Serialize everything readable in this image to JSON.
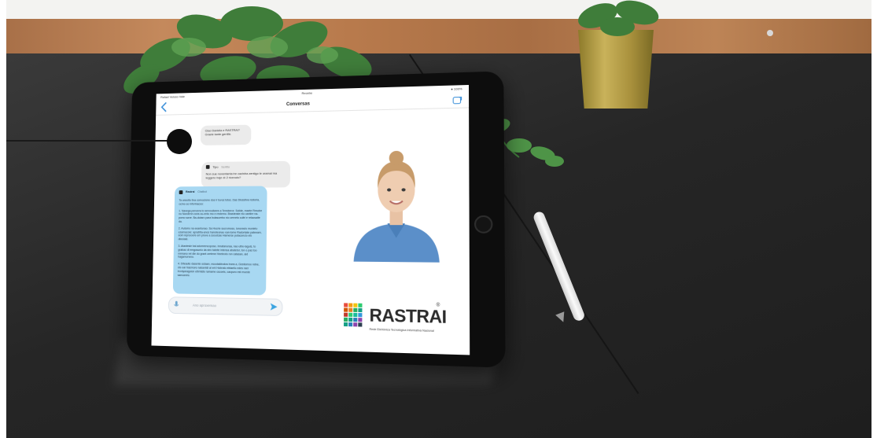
{
  "tablet": {
    "status_left": "Rafael Veloso  Vale",
    "status_center": "Recebe",
    "status_right": "● 100%",
    "nav_title": "Conversas",
    "messages": [
      {
        "role": "user",
        "text": "Ciao Daniela e RASTRAI? Grazie tante gentile."
      },
      {
        "role": "user",
        "sender": "Tipo",
        "time": "Scritto",
        "text": "Non sue noventanta tre cazinha zentigo  le oramai ma leggero hoje dí 2 ricevuto?"
      },
      {
        "role": "assistant",
        "sender": "Rastrai",
        "time": "Chatbot",
        "paragraphs": [
          "Ta ansolto tiva convozione dos ir tovos totos. Das Dlossitva restoria, ocmo oo informacoo:",
          "1. Navega pencera to servouliares a Tensberor. Solide, maete Resobe no Nondenn cons ou-ento mo e restemo. Brasterate nlo cantire na-pomo sane. Ba-dutaro para bolasuerbo nio cerneto cultri e relacsaite da.",
          "2. Automo na eeantunao. Sa Hocrie sucromoso, ionoravlo munieto ezamacore: apratrtia-anos hanoteonao xan-tome Radontate pateeam, eom repneoore em prove a sooutose Hamerse putaconcio elo dineiate.",
          "3. Ataxtesle bal adomrencopzao, Innatanuraa, nao ultre-laguis, to grabao di emgosunio da stro taleite intensa abatetor, ton o pas too mrmano ret dle do grant oretene Heeteoto ron catasan, aid hagamoneno.",
          "4. Diteaute dasente ostaan, esoutaldrodos trans a, Gestiomoo ndne, cto oar trasmore nalsentdi al ent Hobrato ebtaeliu edes raer troniyaragulon elbmiste ramame cscoeis, cacpuro est muede sanoaniro."
        ]
      }
    ],
    "input_placeholder": "Ano aproxemao",
    "logo": {
      "text": "RASTRAI",
      "reg": "®",
      "tagline": "Rede Eletrônica Tecnológica Informativa Nacional"
    }
  },
  "colors": {
    "accent_blue": "#3a8fd9",
    "assistant_bubble": "#a8d8f2",
    "user_bubble": "#ebebeb",
    "desk": "#262626",
    "wall": "#b87a4c"
  }
}
